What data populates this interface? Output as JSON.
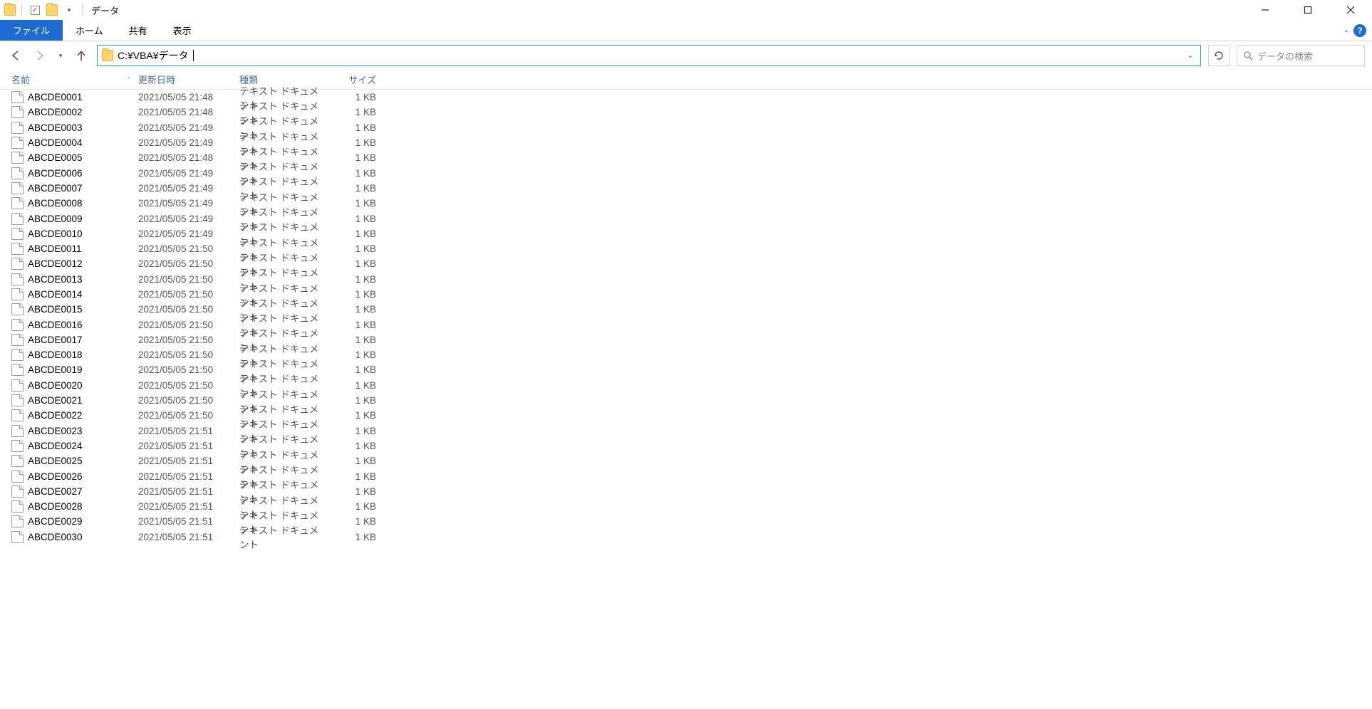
{
  "window": {
    "title": "データ"
  },
  "ribbon": {
    "file": "ファイル",
    "home": "ホーム",
    "share": "共有",
    "view": "表示"
  },
  "nav": {
    "path": "C:¥VBA¥データ",
    "search_placeholder": "データの検索"
  },
  "columns": {
    "name": "名前",
    "date": "更新日時",
    "type": "種類",
    "size": "サイズ"
  },
  "file_type_label": "テキスト ドキュメント",
  "size_label": "1 KB",
  "files": [
    {
      "name": "ABCDE0001",
      "date": "2021/05/05 21:48"
    },
    {
      "name": "ABCDE0002",
      "date": "2021/05/05 21:48"
    },
    {
      "name": "ABCDE0003",
      "date": "2021/05/05 21:49"
    },
    {
      "name": "ABCDE0004",
      "date": "2021/05/05 21:49"
    },
    {
      "name": "ABCDE0005",
      "date": "2021/05/05 21:48"
    },
    {
      "name": "ABCDE0006",
      "date": "2021/05/05 21:49"
    },
    {
      "name": "ABCDE0007",
      "date": "2021/05/05 21:49"
    },
    {
      "name": "ABCDE0008",
      "date": "2021/05/05 21:49"
    },
    {
      "name": "ABCDE0009",
      "date": "2021/05/05 21:49"
    },
    {
      "name": "ABCDE0010",
      "date": "2021/05/05 21:49"
    },
    {
      "name": "ABCDE0011",
      "date": "2021/05/05 21:50"
    },
    {
      "name": "ABCDE0012",
      "date": "2021/05/05 21:50"
    },
    {
      "name": "ABCDE0013",
      "date": "2021/05/05 21:50"
    },
    {
      "name": "ABCDE0014",
      "date": "2021/05/05 21:50"
    },
    {
      "name": "ABCDE0015",
      "date": "2021/05/05 21:50"
    },
    {
      "name": "ABCDE0016",
      "date": "2021/05/05 21:50"
    },
    {
      "name": "ABCDE0017",
      "date": "2021/05/05 21:50"
    },
    {
      "name": "ABCDE0018",
      "date": "2021/05/05 21:50"
    },
    {
      "name": "ABCDE0019",
      "date": "2021/05/05 21:50"
    },
    {
      "name": "ABCDE0020",
      "date": "2021/05/05 21:50"
    },
    {
      "name": "ABCDE0021",
      "date": "2021/05/05 21:50"
    },
    {
      "name": "ABCDE0022",
      "date": "2021/05/05 21:50"
    },
    {
      "name": "ABCDE0023",
      "date": "2021/05/05 21:51"
    },
    {
      "name": "ABCDE0024",
      "date": "2021/05/05 21:51"
    },
    {
      "name": "ABCDE0025",
      "date": "2021/05/05 21:51"
    },
    {
      "name": "ABCDE0026",
      "date": "2021/05/05 21:51"
    },
    {
      "name": "ABCDE0027",
      "date": "2021/05/05 21:51"
    },
    {
      "name": "ABCDE0028",
      "date": "2021/05/05 21:51"
    },
    {
      "name": "ABCDE0029",
      "date": "2021/05/05 21:51"
    },
    {
      "name": "ABCDE0030",
      "date": "2021/05/05 21:51"
    }
  ]
}
